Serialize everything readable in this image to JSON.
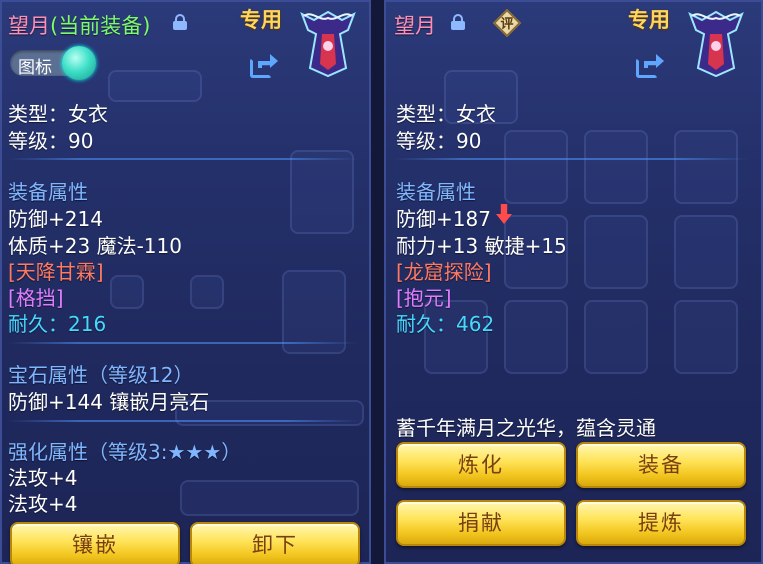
{
  "left": {
    "item_name": "望月",
    "equipped_tag": "(当前装备)",
    "exclusive_label": "专用",
    "toggle_label": "图标",
    "type_line": "类型：女衣",
    "level_line": "等级：90",
    "equip_attr_title": "装备属性",
    "attr_lines": [
      "防御+214",
      "体质+23 魔法-110"
    ],
    "special_effect": "[天降甘霖]",
    "special_skill": "[格挡]",
    "durability": "耐久：216",
    "gem_title": "宝石属性（等级12）",
    "gem_line": "防御+144 镶嵌月亮石",
    "enhance_title": "强化属性（等级3:★★★）",
    "enhance_lines": [
      "法攻+4",
      "法攻+4"
    ],
    "buttons": [
      "镶嵌",
      "卸下"
    ]
  },
  "right": {
    "item_name": "望月",
    "eval_badge": "评",
    "exclusive_label": "专用",
    "type_line": "类型：女衣",
    "level_line": "等级：90",
    "equip_attr_title": "装备属性",
    "attr_lines": [
      "防御+187",
      "耐力+13 敏捷+15"
    ],
    "special_effect": "[龙窟探险]",
    "special_skill": "[抱元]",
    "durability": "耐久：462",
    "description": "蓄千年满月之光华，蕴含灵通",
    "buttons": [
      "炼化",
      "装备",
      "捐献",
      "提炼"
    ]
  },
  "colors": {
    "name_pink": "#ff8fb4",
    "equipped_green": "#7dfc6a",
    "exclusive_gold": "#ffd55a",
    "special_effect": "#ff7a62",
    "special_skill": "#e07cff",
    "durability_cyan": "#46d9ff",
    "section_blue": "#7fb6ff",
    "button_gold": "#ffe45a",
    "panel_bg": "#24306a"
  },
  "icons": [
    "lock-icon",
    "share-icon",
    "eval-badge-icon",
    "down-arrow-icon",
    "robe-item-icon"
  ]
}
